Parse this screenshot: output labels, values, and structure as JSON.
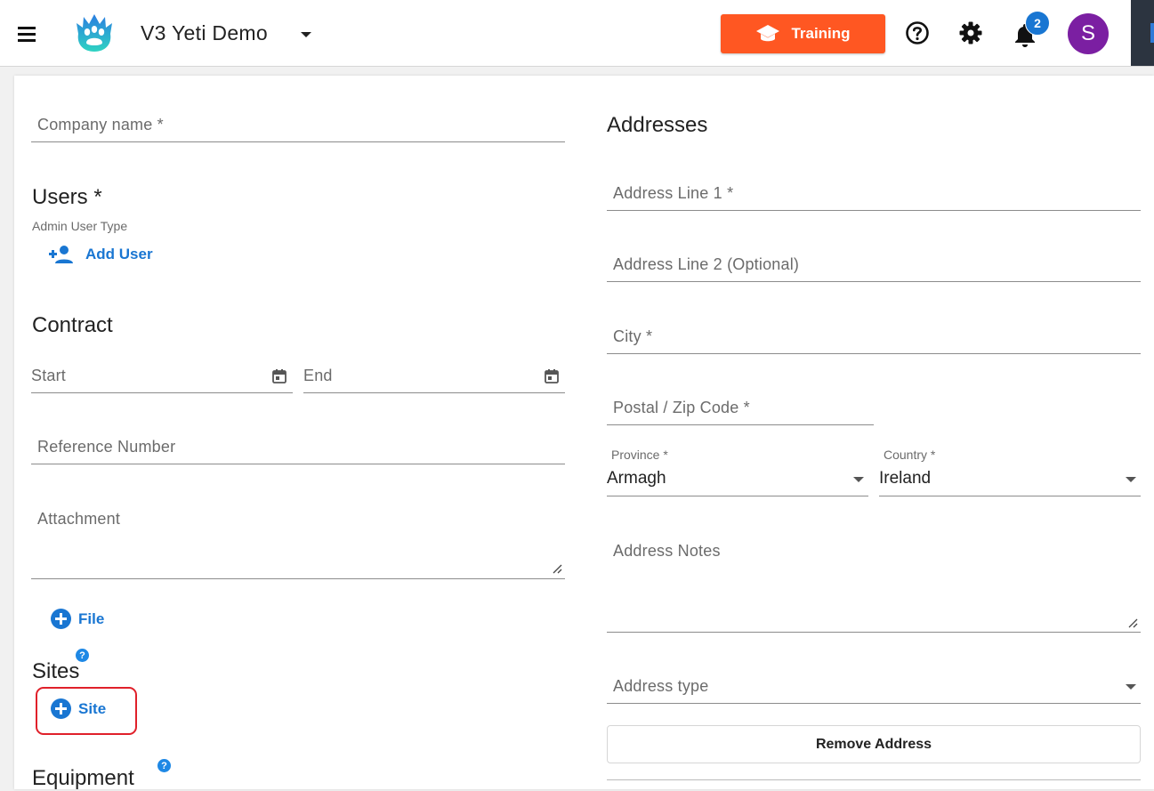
{
  "header": {
    "app_title": "V3 Yeti Demo",
    "training_label": "Training",
    "notification_count": "2",
    "avatar_initial": "S",
    "colors": {
      "training": "#ff5722",
      "avatar": "#7b1fa2",
      "badge": "#1976d2"
    },
    "icons": [
      "menu-icon",
      "yeti-paw-logo",
      "graduation-cap-icon",
      "help-circle-icon",
      "gear-icon",
      "bell-icon"
    ]
  },
  "left": {
    "company_name": {
      "placeholder": "Company name *",
      "value": ""
    },
    "users": {
      "title": "Users *",
      "subtitle": "Admin User Type",
      "add_user_label": "Add User"
    },
    "contract": {
      "title": "Contract",
      "start_placeholder": "Start",
      "end_placeholder": "End",
      "reference_placeholder": "Reference Number",
      "attachment_placeholder": "Attachment",
      "file_button_label": "File"
    },
    "sites": {
      "title": "Sites",
      "help": "?",
      "add_site_label": "Site"
    },
    "equipment": {
      "title": "Equipment",
      "help": "?"
    }
  },
  "right": {
    "title": "Addresses",
    "address_line1": "Address Line 1 *",
    "address_line2": "Address Line 2 (Optional)",
    "city": "City *",
    "postal_code": "Postal / Zip Code *",
    "province": {
      "label": "Province *",
      "value": "Armagh"
    },
    "country": {
      "label": "Country *",
      "value": "Ireland"
    },
    "address_notes": "Address Notes",
    "address_type": "Address type",
    "remove_address_label": "Remove Address"
  },
  "accent_color": "#1976d2",
  "highlight_color": "#e0202a"
}
